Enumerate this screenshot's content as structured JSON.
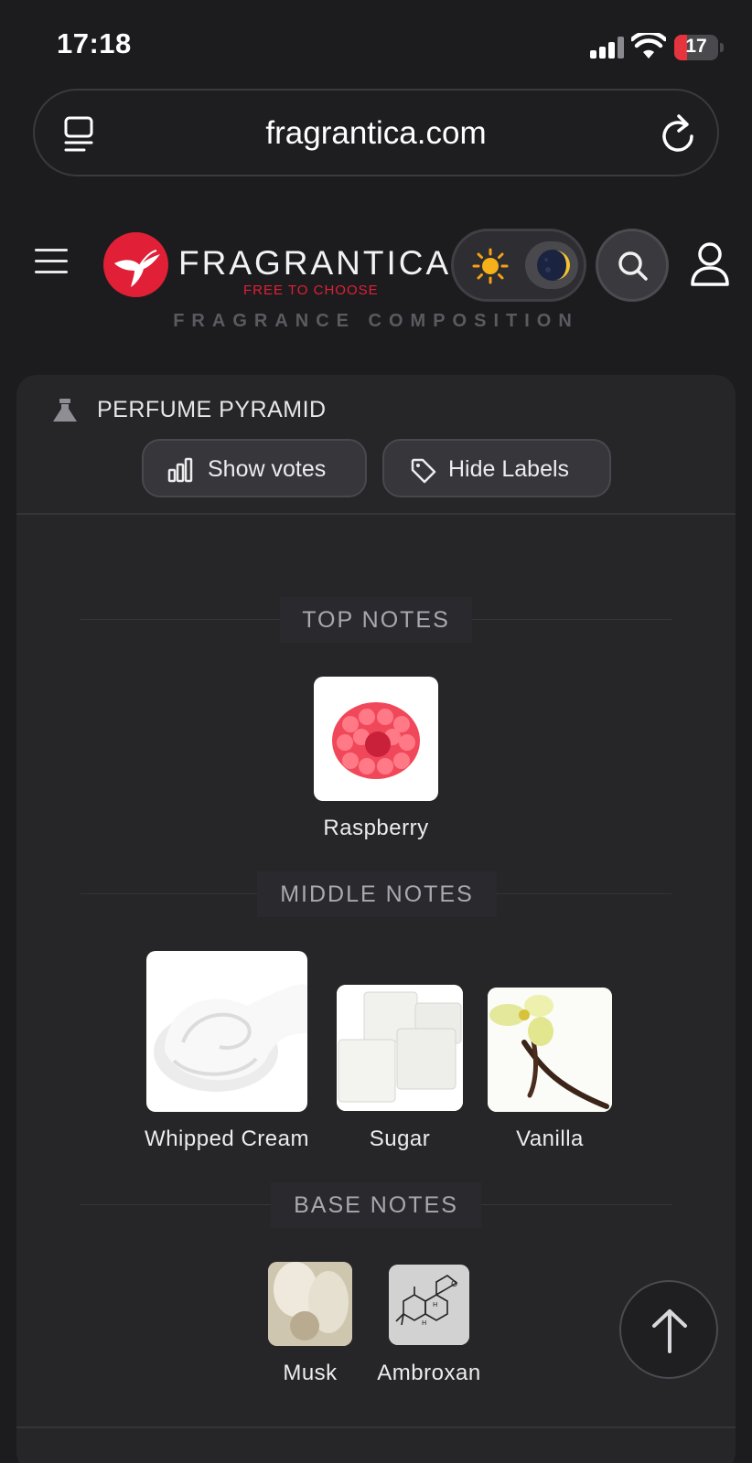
{
  "status_bar": {
    "time": "17:18",
    "battery": "17"
  },
  "browser": {
    "url": "fragrantica.com"
  },
  "site": {
    "brand": "FRAGRANTICA",
    "tagline": "FREE TO CHOOSE",
    "section_title": "FRAGRANCE COMPOSITION"
  },
  "pyramid": {
    "title": "PERFUME PYRAMID",
    "show_votes_label": "Show votes",
    "hide_labels_label": "Hide Labels",
    "top_heading": "TOP NOTES",
    "top_notes": [
      {
        "name": "Raspberry"
      }
    ],
    "middle_heading": "MIDDLE NOTES",
    "middle_notes": [
      {
        "name": "Whipped Cream"
      },
      {
        "name": "Sugar"
      },
      {
        "name": "Vanilla"
      }
    ],
    "base_heading": "BASE NOTES",
    "base_notes": [
      {
        "name": "Musk"
      },
      {
        "name": "Ambroxan"
      }
    ]
  },
  "colors": {
    "brand_red": "#e11f36",
    "background": "#1c1c1f",
    "card": "#262629"
  },
  "icons": [
    "tabs-icon",
    "reload-icon",
    "menu-icon",
    "logo-bird-icon",
    "sun-icon",
    "moon-icon",
    "search-icon",
    "user-icon",
    "flask-icon",
    "bar-chart-icon",
    "tag-icon",
    "arrow-up-icon"
  ]
}
